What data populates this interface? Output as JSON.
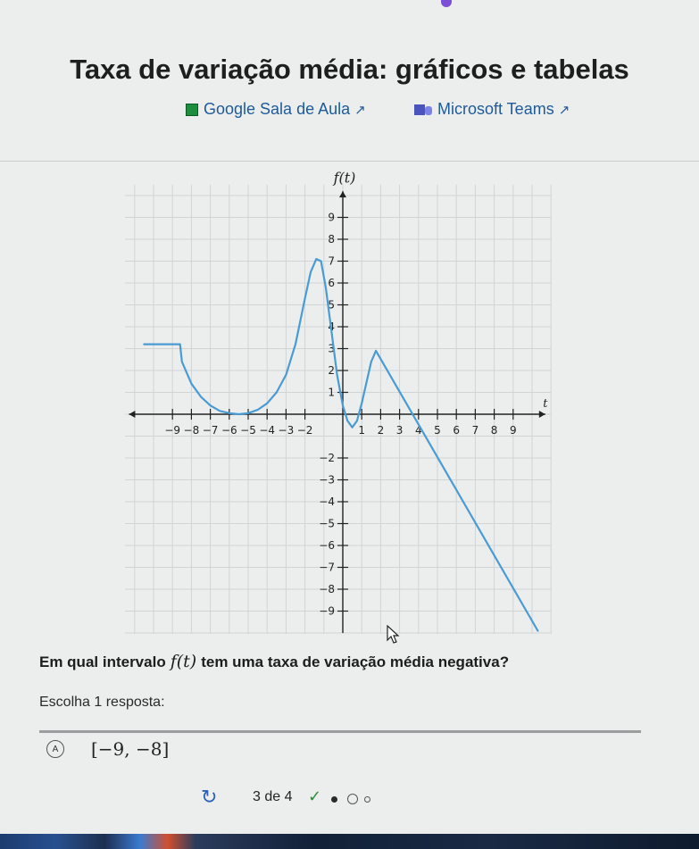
{
  "page": {
    "title": "Taxa de variação média: gráficos e tabelas",
    "links": [
      {
        "label": "Google Sala de Aula",
        "icon": "google-classroom-icon"
      },
      {
        "label": "Microsoft Teams",
        "icon": "microsoft-teams-icon"
      }
    ],
    "external_icon": "↗"
  },
  "chart_data": {
    "type": "line",
    "ylabel": "f(t)",
    "xlabel": "t",
    "xlim": [
      -10,
      10
    ],
    "ylim": [
      -10,
      10
    ],
    "x_ticks": [
      -9,
      -8,
      -7,
      -6,
      -5,
      -4,
      -3,
      -2,
      1,
      2,
      3,
      4,
      5,
      6,
      7,
      8,
      9
    ],
    "y_ticks": [
      9,
      8,
      7,
      6,
      5,
      4,
      3,
      2,
      1,
      -2,
      -3,
      -4,
      -5,
      -6,
      -7,
      -8,
      -9
    ],
    "x_tick_labels": [
      "−9",
      "−8",
      "−7",
      "−6",
      "−5",
      "−4",
      "−3",
      "−2",
      "1",
      "2",
      "3",
      "4",
      "5",
      "6",
      "7",
      "8",
      "9"
    ],
    "y_tick_labels": [
      "9",
      "8",
      "7",
      "6",
      "5",
      "4",
      "3",
      "2",
      "1",
      "−2",
      "−3",
      "−4",
      "−5",
      "−6",
      "−7",
      "−8",
      "−9"
    ],
    "grid": true,
    "line_color": "#4a9bd3",
    "series": [
      {
        "values": [
          [
            -10.5,
            3.2
          ],
          [
            -8.6,
            3.2
          ],
          [
            -8.5,
            2.4
          ],
          [
            -8.0,
            1.4
          ],
          [
            -7.5,
            0.8
          ],
          [
            -7.0,
            0.4
          ],
          [
            -6.5,
            0.15
          ],
          [
            -6.0,
            0.05
          ],
          [
            -5.5,
            0.0
          ],
          [
            -5.0,
            0.05
          ],
          [
            -4.5,
            0.2
          ],
          [
            -4.0,
            0.5
          ],
          [
            -3.5,
            1.0
          ],
          [
            -3.0,
            1.8
          ],
          [
            -2.5,
            3.2
          ],
          [
            -2.0,
            5.3
          ],
          [
            -1.7,
            6.5
          ],
          [
            -1.4,
            7.1
          ],
          [
            -1.15,
            7.0
          ],
          [
            -0.9,
            5.8
          ],
          [
            -0.6,
            3.8
          ],
          [
            -0.3,
            1.8
          ],
          [
            0.0,
            0.4
          ],
          [
            0.25,
            -0.3
          ],
          [
            0.5,
            -0.6
          ],
          [
            0.75,
            -0.3
          ],
          [
            1.0,
            0.5
          ],
          [
            1.5,
            2.4
          ],
          [
            1.75,
            2.9
          ],
          [
            10.3,
            -9.9
          ]
        ]
      }
    ]
  },
  "question": {
    "prefix": "Em qual intervalo",
    "function": "f(t)",
    "suffix": "tem uma taxa de variação média negativa?"
  },
  "instruction": "Escolha 1 resposta:",
  "options": [
    {
      "letter": "A",
      "text": "[−9, −8]"
    }
  ],
  "pager": {
    "label": "3 de 4",
    "check": "✓",
    "refresh": "↻"
  }
}
